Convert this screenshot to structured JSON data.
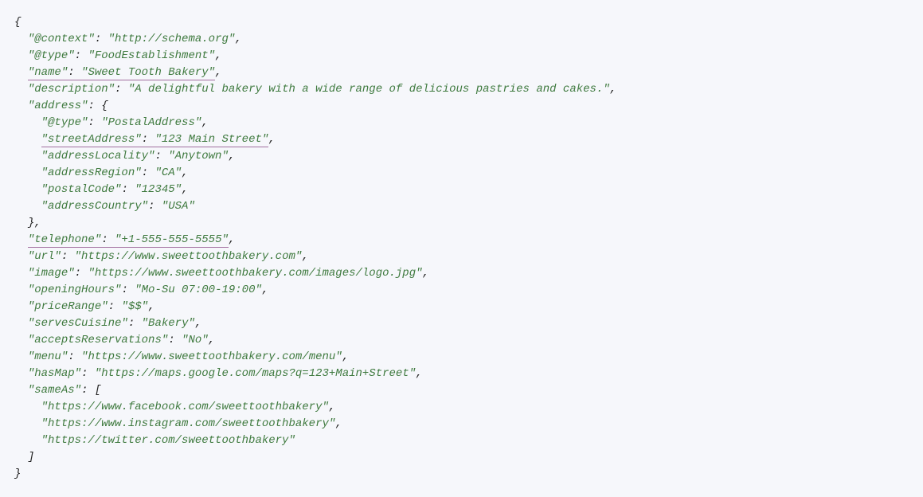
{
  "code": {
    "lines": [
      {
        "indent": 0,
        "type": "brace",
        "text": "{"
      },
      {
        "indent": 1,
        "key": "\"@context\"",
        "value": "\"http://schema.org\"",
        "comma": true
      },
      {
        "indent": 1,
        "key": "\"@type\"",
        "value": "\"FoodEstablishment\"",
        "comma": true
      },
      {
        "indent": 1,
        "key": "\"name\"",
        "value": "\"Sweet Tooth Bakery\"",
        "comma": true,
        "underlined": true
      },
      {
        "indent": 1,
        "key": "\"description\"",
        "value": "\"A delightful bakery with a wide range of delicious pastries and cakes.\"",
        "comma": true
      },
      {
        "indent": 1,
        "key": "\"address\"",
        "value": "{",
        "comma": false,
        "openBrace": true
      },
      {
        "indent": 2,
        "key": "\"@type\"",
        "value": "\"PostalAddress\"",
        "comma": true
      },
      {
        "indent": 2,
        "key": "\"streetAddress\"",
        "value": "\"123 Main Street\"",
        "comma": true,
        "underlined": true
      },
      {
        "indent": 2,
        "key": "\"addressLocality\"",
        "value": "\"Anytown\"",
        "comma": true
      },
      {
        "indent": 2,
        "key": "\"addressRegion\"",
        "value": "\"CA\"",
        "comma": true
      },
      {
        "indent": 2,
        "key": "\"postalCode\"",
        "value": "\"12345\"",
        "comma": true
      },
      {
        "indent": 2,
        "key": "\"addressCountry\"",
        "value": "\"USA\"",
        "comma": false
      },
      {
        "indent": 1,
        "type": "brace",
        "text": "},"
      },
      {
        "indent": 1,
        "key": "\"telephone\"",
        "value": "\"+1-555-555-5555\"",
        "comma": true,
        "underlined": true
      },
      {
        "indent": 1,
        "key": "\"url\"",
        "value": "\"https://www.sweettoothbakery.com\"",
        "comma": true
      },
      {
        "indent": 1,
        "key": "\"image\"",
        "value": "\"https://www.sweettoothbakery.com/images/logo.jpg\"",
        "comma": true
      },
      {
        "indent": 1,
        "key": "\"openingHours\"",
        "value": "\"Mo-Su 07:00-19:00\"",
        "comma": true
      },
      {
        "indent": 1,
        "key": "\"priceRange\"",
        "value": "\"$$\"",
        "comma": true
      },
      {
        "indent": 1,
        "key": "\"servesCuisine\"",
        "value": "\"Bakery\"",
        "comma": true
      },
      {
        "indent": 1,
        "key": "\"acceptsReservations\"",
        "value": "\"No\"",
        "comma": true
      },
      {
        "indent": 1,
        "key": "\"menu\"",
        "value": "\"https://www.sweettoothbakery.com/menu\"",
        "comma": true
      },
      {
        "indent": 1,
        "key": "\"hasMap\"",
        "value": "\"https://maps.google.com/maps?q=123+Main+Street\"",
        "comma": true
      },
      {
        "indent": 1,
        "key": "\"sameAs\"",
        "value": "[",
        "comma": false,
        "openBracket": true
      },
      {
        "indent": 2,
        "type": "arrayitem",
        "value": "\"https://www.facebook.com/sweettoothbakery\"",
        "comma": true
      },
      {
        "indent": 2,
        "type": "arrayitem",
        "value": "\"https://www.instagram.com/sweettoothbakery\"",
        "comma": true
      },
      {
        "indent": 2,
        "type": "arrayitem",
        "value": "\"https://twitter.com/sweettoothbakery\"",
        "comma": false
      },
      {
        "indent": 1,
        "type": "brace",
        "text": "]"
      },
      {
        "indent": 0,
        "type": "brace",
        "text": "}"
      }
    ]
  }
}
